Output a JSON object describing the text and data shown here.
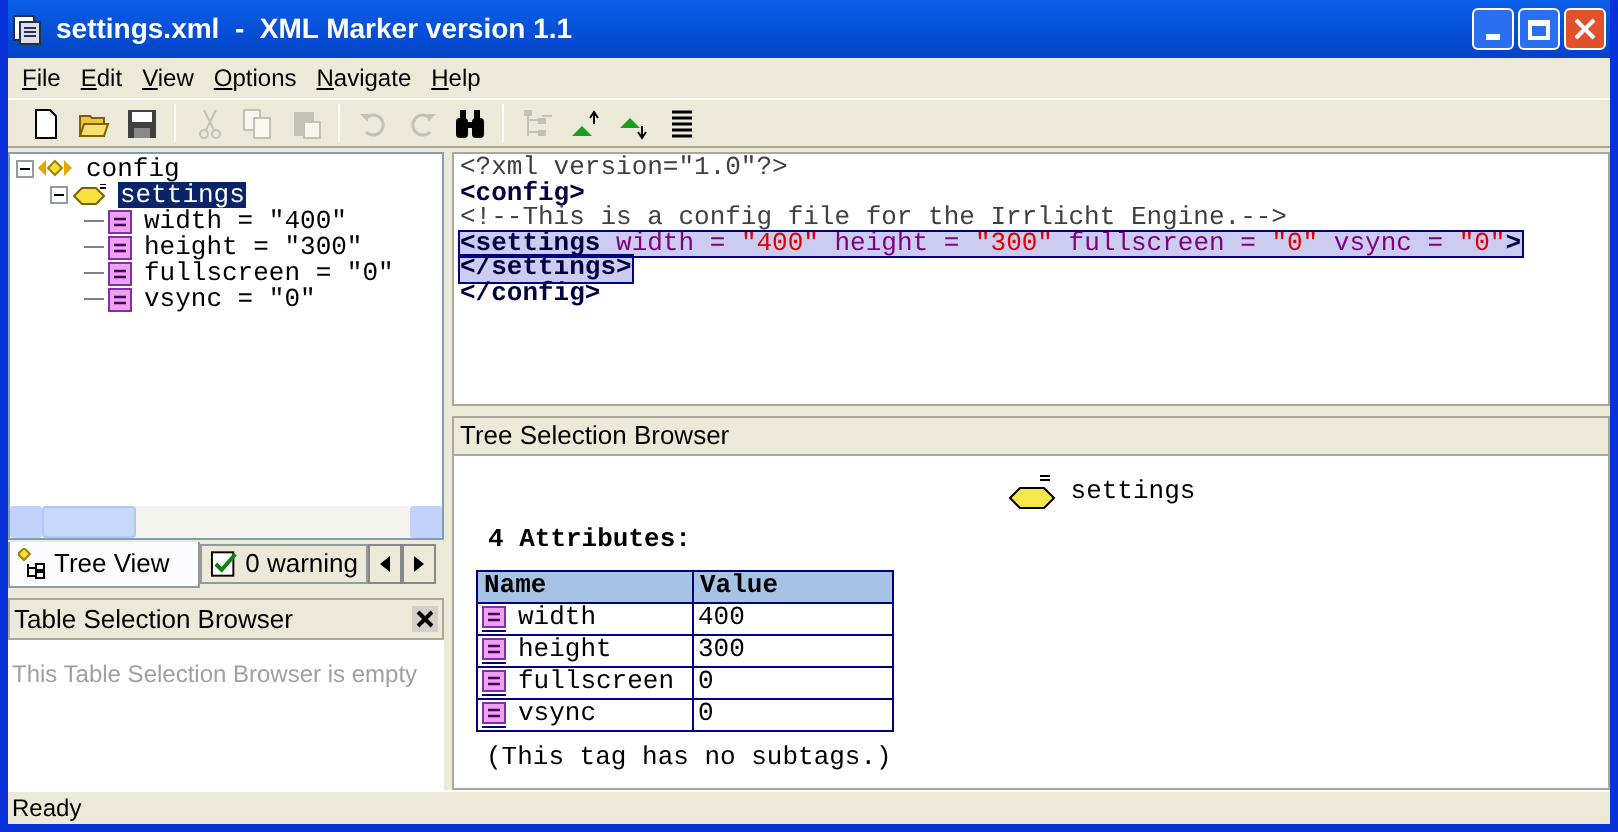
{
  "window": {
    "title": "settings.xml  -  XML Marker version 1.1"
  },
  "menu": [
    {
      "label": "File"
    },
    {
      "label": "Edit"
    },
    {
      "label": "View"
    },
    {
      "label": "Options"
    },
    {
      "label": "Navigate"
    },
    {
      "label": "Help"
    }
  ],
  "toolbar": [
    {
      "kind": "new",
      "disabled": false
    },
    {
      "kind": "open",
      "disabled": false
    },
    {
      "kind": "save",
      "disabled": false
    },
    {
      "kind": "sep"
    },
    {
      "kind": "cut",
      "disabled": true
    },
    {
      "kind": "copy",
      "disabled": true
    },
    {
      "kind": "paste",
      "disabled": true
    },
    {
      "kind": "sep"
    },
    {
      "kind": "undo",
      "disabled": true
    },
    {
      "kind": "redo",
      "disabled": true
    },
    {
      "kind": "find",
      "disabled": false
    },
    {
      "kind": "sep"
    },
    {
      "kind": "tree",
      "disabled": true
    },
    {
      "kind": "up",
      "disabled": false
    },
    {
      "kind": "down",
      "disabled": false
    },
    {
      "kind": "list",
      "disabled": false
    }
  ],
  "tree": [
    {
      "label": "config",
      "kind": "element",
      "expanded": true,
      "selected": false,
      "children": [
        {
          "label": "settings",
          "kind": "element",
          "expanded": true,
          "selected": true,
          "children": [
            {
              "label": "width = \"400\"",
              "kind": "attribute",
              "selected": false
            },
            {
              "label": "height = \"300\"",
              "kind": "attribute",
              "selected": false
            },
            {
              "label": "fullscreen = \"0\"",
              "kind": "attribute",
              "selected": false
            },
            {
              "label": "vsync = \"0\"",
              "kind": "attribute",
              "selected": false
            }
          ]
        }
      ]
    }
  ],
  "left_tabs": [
    {
      "label": "Tree View",
      "kind": "tree",
      "selected": true
    },
    {
      "label": "0 warning",
      "kind": "warnings",
      "selected": false
    }
  ],
  "table_browser": {
    "title": "Table Selection Browser",
    "message": "This Table Selection Browser is empty"
  },
  "editor": {
    "lines": [
      {
        "selected": false,
        "tokens": [
          {
            "kind": "pi",
            "text": "<?xml version=\"1.0\"?>"
          }
        ]
      },
      {
        "selected": false,
        "tokens": [
          {
            "kind": "tag",
            "text": "<config>"
          }
        ]
      },
      {
        "selected": false,
        "tokens": [
          {
            "kind": "comment",
            "text": "<!--This is a config file for the Irrlicht Engine.-->"
          }
        ]
      },
      {
        "selected": true,
        "tokens": [
          {
            "kind": "tag",
            "text": "<settings"
          },
          {
            "kind": "attr",
            "text": " width = "
          },
          {
            "kind": "value",
            "text": "\"400\""
          },
          {
            "kind": "attr",
            "text": " height = "
          },
          {
            "kind": "value",
            "text": "\"300\""
          },
          {
            "kind": "attr",
            "text": " fullscreen = "
          },
          {
            "kind": "value",
            "text": "\"0\""
          },
          {
            "kind": "attr",
            "text": " vsync = "
          },
          {
            "kind": "value",
            "text": "\"0\""
          },
          {
            "kind": "tag",
            "text": ">"
          }
        ]
      },
      {
        "selected": true,
        "tokens": [
          {
            "kind": "tag",
            "text": "</settings>"
          }
        ]
      },
      {
        "selected": false,
        "tokens": [
          {
            "kind": "tag",
            "text": "</config>"
          }
        ]
      }
    ]
  },
  "tree_browser": {
    "title": "Tree Selection Browser",
    "node": "settings",
    "attributes_heading": "4 Attributes:",
    "columns": [
      "Name",
      "Value"
    ],
    "rows": [
      [
        "width",
        "400"
      ],
      [
        "height",
        "300"
      ],
      [
        "fullscreen",
        "0"
      ],
      [
        "vsync",
        "0"
      ]
    ],
    "note": "(This tag has no subtags.)"
  },
  "status_bar": {
    "text": "Ready"
  }
}
